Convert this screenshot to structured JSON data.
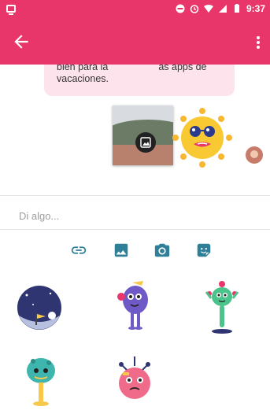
{
  "status_bar": {
    "time": "9:37"
  },
  "chat": {
    "message_line1": "bien para la",
    "message_line1_end": "as apps de",
    "message_line2": "vacaciones."
  },
  "compose": {
    "placeholder": "Di algo..."
  },
  "colors": {
    "accent": "#e8366a",
    "bubble": "#fde4ec",
    "toolbar_icons": "#2f7f99"
  },
  "icons": {
    "back": "arrow-back-icon",
    "menu": "more-vert-icon",
    "link": "link-icon",
    "image": "image-icon",
    "camera": "camera-icon",
    "sticker": "sticker-icon"
  }
}
